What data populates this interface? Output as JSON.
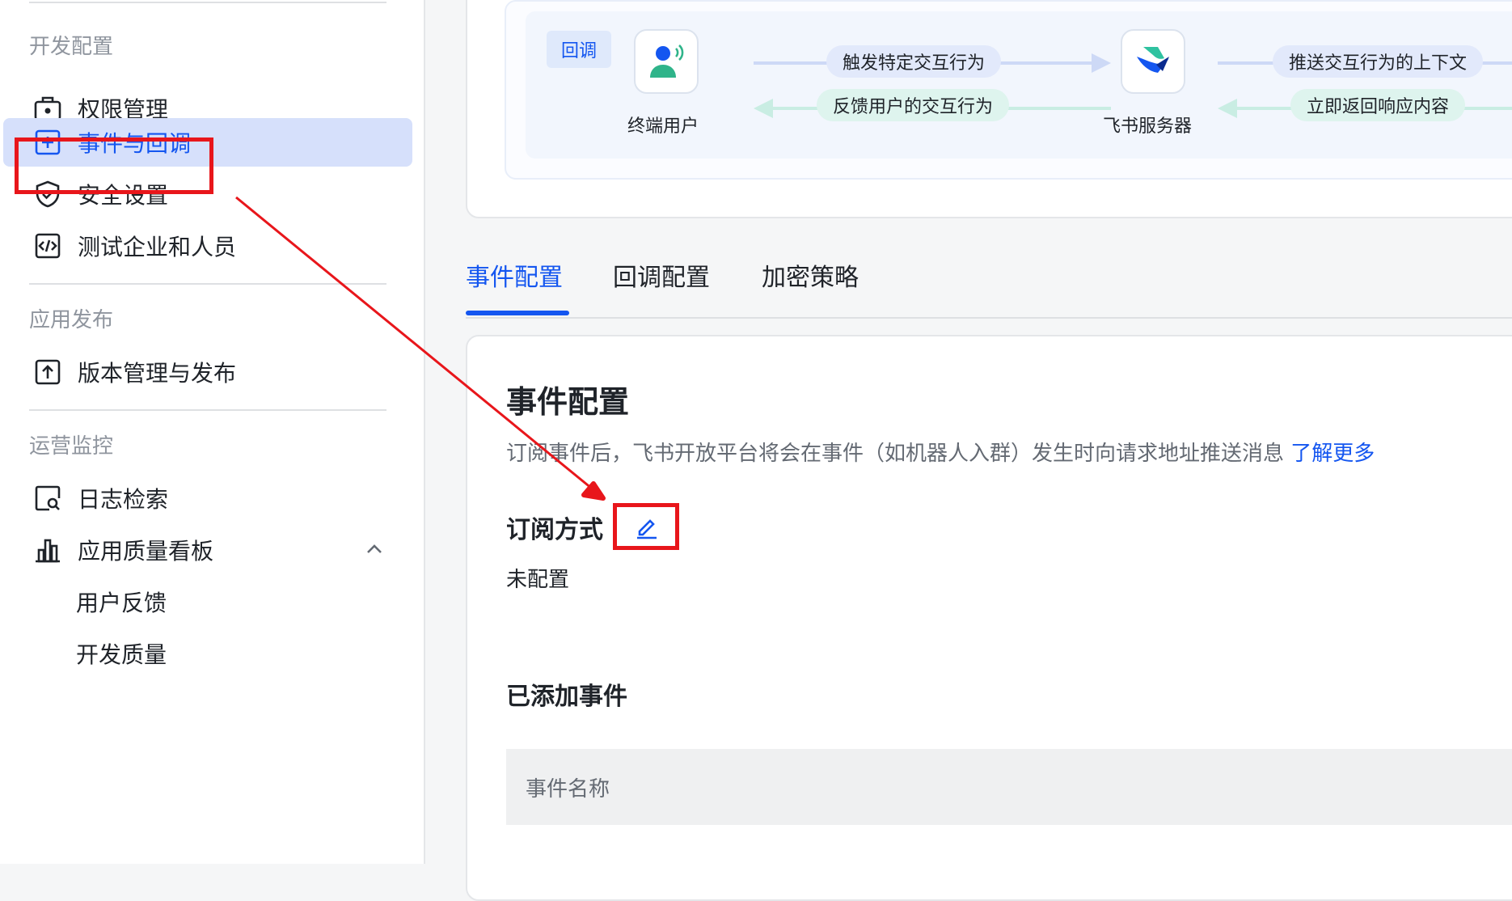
{
  "sidebar": {
    "sections": [
      {
        "title": "开发配置"
      },
      {
        "title": "应用发布"
      },
      {
        "title": "运营监控"
      }
    ],
    "items": [
      {
        "label": "权限管理",
        "icon": "briefcase-icon"
      },
      {
        "label": "事件与回调",
        "icon": "add-square-icon",
        "active": true
      },
      {
        "label": "安全设置",
        "icon": "shield-check-icon"
      },
      {
        "label": "测试企业和人员",
        "icon": "code-square-icon"
      },
      {
        "label": "版本管理与发布",
        "icon": "upload-square-icon"
      },
      {
        "label": "日志检索",
        "icon": "log-search-icon"
      },
      {
        "label": "应用质量看板",
        "icon": "bar-chart-icon"
      },
      {
        "label": "用户反馈"
      },
      {
        "label": "开发质量"
      }
    ]
  },
  "flow": {
    "tag": "回调",
    "end_user": "终端用户",
    "server": "飞书服务器",
    "pill_trigger": "触发特定交互行为",
    "pill_feedback": "反馈用户的交互行为",
    "pill_push": "推送交互行为的上下文",
    "pill_return": "立即返回响应内容"
  },
  "tabs": [
    {
      "label": "事件配置",
      "active": true
    },
    {
      "label": "回调配置"
    },
    {
      "label": "加密策略"
    }
  ],
  "content": {
    "title": "事件配置",
    "description": "订阅事件后，飞书开放平台将会在事件（如机器人入群）发生时向请求地址推送消息",
    "learn_more": "了解更多",
    "subscription_label": "订阅方式",
    "subscription_value": "未配置",
    "added_events_title": "已添加事件",
    "table_header_name": "事件名称"
  },
  "colors": {
    "accent": "#1456f0",
    "annotation": "#e8161b",
    "active_bg": "#d6e0fb"
  }
}
